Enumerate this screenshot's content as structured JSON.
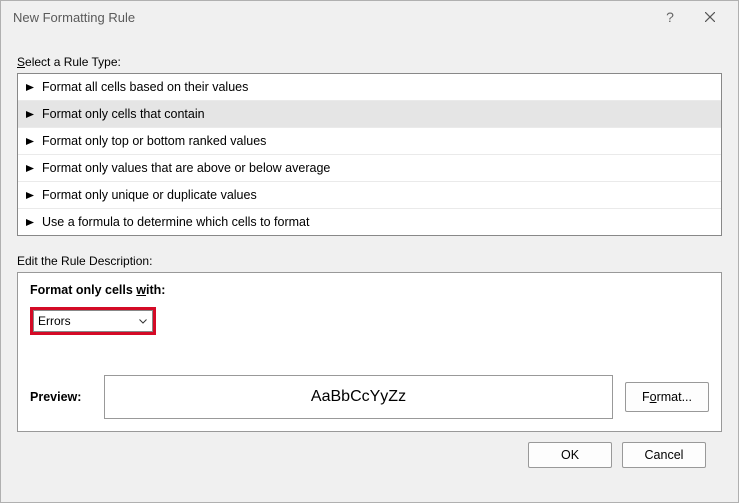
{
  "window": {
    "title": "New Formatting Rule",
    "help": "?",
    "close": "×"
  },
  "ruleTypeLabel_prefix": "S",
  "ruleTypeLabel_suffix": "elect a Rule Type:",
  "ruleTypes": {
    "items": [
      "Format all cells based on their values",
      "Format only cells that contain",
      "Format only top or bottom ranked values",
      "Format only values that are above or below average",
      "Format only unique or duplicate values",
      "Use a formula to determine which cells to format"
    ],
    "selectedIndex": 1
  },
  "editDescLabel": "Edit the Rule Description:",
  "descHeading_prefix": "Format only cells ",
  "descHeading_suffix_pre": "w",
  "descHeading_suffix_post": "ith:",
  "dropdown": {
    "value": "Errors"
  },
  "preview": {
    "label": "Preview:",
    "sample": "AaBbCcYyZz"
  },
  "buttons": {
    "format_pre": "F",
    "format_post": "rmat...",
    "format_underlined": "o",
    "ok": "OK",
    "cancel": "Cancel"
  }
}
